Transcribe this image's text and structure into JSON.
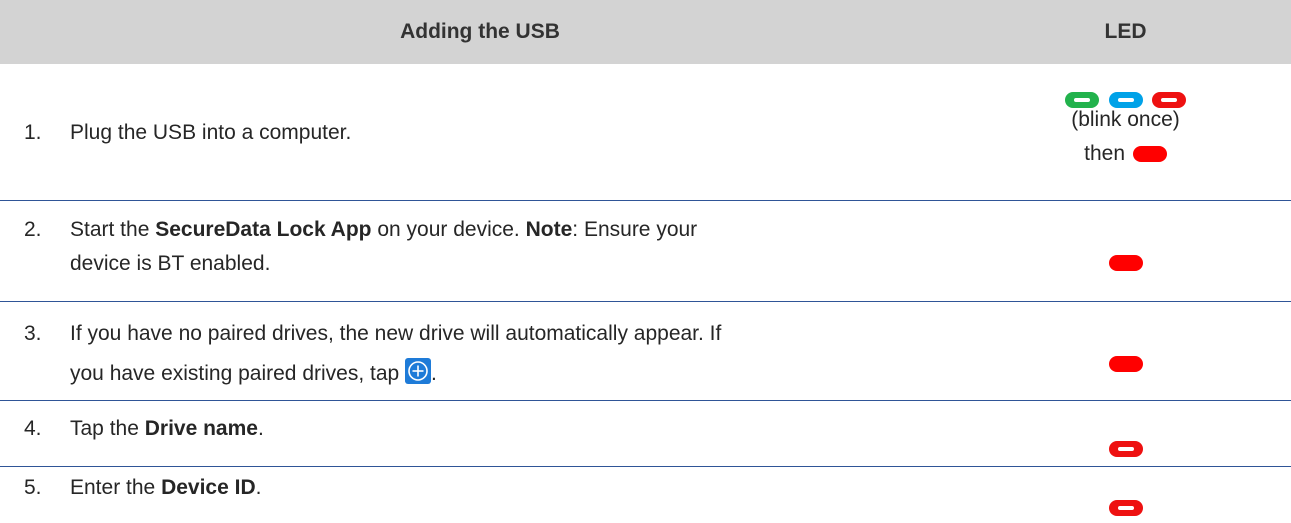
{
  "header": {
    "step_col": "Adding the USB",
    "led_col": "LED"
  },
  "rows": [
    {
      "num": "1.",
      "parts": [
        "Plug the USB into a computer."
      ],
      "led": {
        "blink_note": "(blink once)",
        "then": "then"
      }
    },
    {
      "num": "2.",
      "parts": [
        "Start the ",
        "SecureData Lock App",
        " on your device. ",
        "Note",
        ": Ensure your device is BT enabled."
      ],
      "led": {}
    },
    {
      "num": "3.",
      "parts": [
        "If you have no paired drives, the new drive will automatically appear. If you have existing paired drives, tap ",
        "."
      ],
      "led": {}
    },
    {
      "num": "4.",
      "parts": [
        "Tap the ",
        "Drive name",
        "."
      ],
      "led": {}
    },
    {
      "num": "5.",
      "parts": [
        "Enter the ",
        "Device ID",
        "."
      ],
      "led": {}
    }
  ],
  "colors": {
    "header_bg": "#d3d3d3",
    "row_divider": "#2f5597",
    "led_green": "#22b24c",
    "led_blue": "#00a2e8",
    "led_red": "#ff0000",
    "add_icon_bg": "#1e7bd8"
  },
  "icons": {
    "add_drive": "plus-circle-icon"
  }
}
